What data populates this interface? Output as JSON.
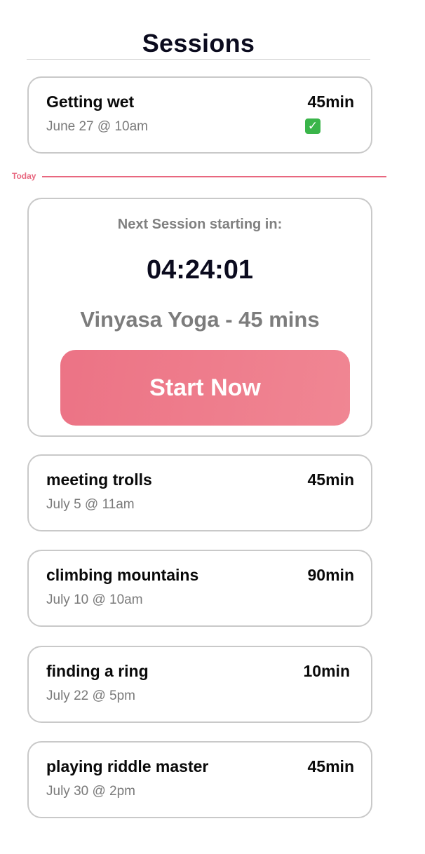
{
  "header": {
    "title": "Sessions"
  },
  "past_sessions": [
    {
      "title": "Getting wet",
      "date": "June 27 @ 10am",
      "duration": "45min",
      "status_icon": "check-mark-icon",
      "status_symbol": "✓"
    }
  ],
  "today": {
    "label": "Today",
    "color": "#e8677f"
  },
  "next_session": {
    "label": "Next Session starting in:",
    "countdown": "04:24:01",
    "name": "Vinyasa Yoga - 45 mins",
    "button_label": "Start Now",
    "button_color": "#ee7a8b"
  },
  "upcoming_sessions": [
    {
      "title": "meeting trolls",
      "date": "July 5 @ 11am",
      "duration": "45min"
    },
    {
      "title": "climbing mountains",
      "date": "July 10 @ 10am",
      "duration": "90min"
    },
    {
      "title": "finding a ring",
      "date": "July 22 @ 5pm",
      "duration": "10min"
    },
    {
      "title": "playing riddle master",
      "date": "July 30 @ 2pm",
      "duration": "45min"
    }
  ]
}
